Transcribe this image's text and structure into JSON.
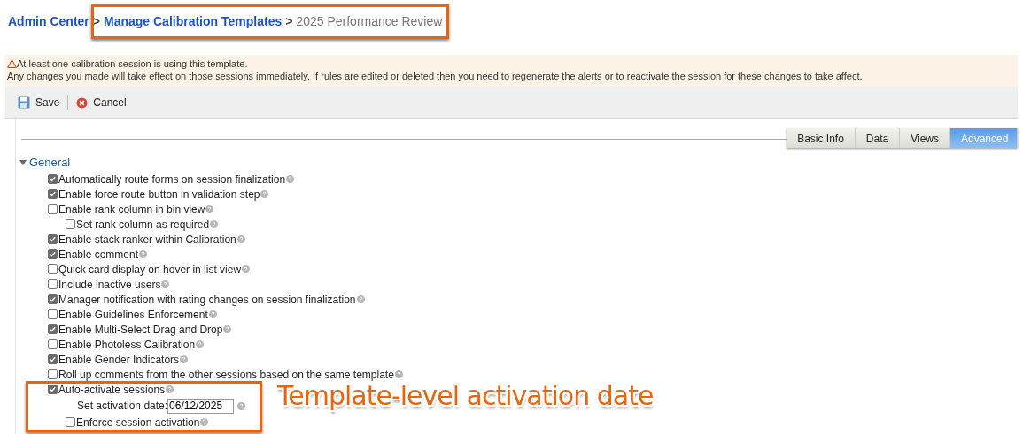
{
  "breadcrumb": [
    {
      "label": "Admin Center",
      "kind": "link"
    },
    {
      "label": "Manage Calibration Templates",
      "kind": "link"
    },
    {
      "label": "2025 Performance Review",
      "kind": "current"
    }
  ],
  "breadcrumb_separator": ">",
  "alert": {
    "title": "At least one calibration session is using this template.",
    "message": "Any changes you made will take effect on those sessions immediately. If rules are edited or deleted then you need to regenerate the alerts or to reactivate the session for these changes to take affect."
  },
  "toolbar": [
    {
      "label": "Save",
      "kind": "save"
    },
    {
      "label": "Cancel",
      "kind": "cancel"
    }
  ],
  "tabs": [
    {
      "label": "Basic Info",
      "selected": false
    },
    {
      "label": "Data",
      "selected": false
    },
    {
      "label": "Views",
      "selected": false
    },
    {
      "label": "Advanced",
      "selected": true
    }
  ],
  "section": {
    "title": "General",
    "expanded": true,
    "items": [
      {
        "kind": "checkbox",
        "label": "Automatically route forms on session finalization",
        "checked": true
      },
      {
        "kind": "checkbox",
        "label": "Enable force route button in validation step",
        "checked": true
      },
      {
        "kind": "checkbox",
        "label": "Enable rank column in bin view",
        "checked": false,
        "children": [
          {
            "kind": "checkbox",
            "label": "Set rank column as required",
            "checked": false
          }
        ]
      },
      {
        "kind": "checkbox",
        "label": "Enable stack ranker within Calibration",
        "checked": true
      },
      {
        "kind": "checkbox",
        "label": "Enable comment",
        "checked": true
      },
      {
        "kind": "checkbox",
        "label": "Quick card display on hover in list view",
        "checked": false
      },
      {
        "kind": "checkbox",
        "label": "Include inactive users",
        "checked": false
      },
      {
        "kind": "checkbox",
        "label": "Manager notification with rating changes on session finalization",
        "checked": true
      },
      {
        "kind": "checkbox",
        "label": "Enable Guidelines Enforcement",
        "checked": false
      },
      {
        "kind": "checkbox",
        "label": "Enable Multi-Select Drag and Drop",
        "checked": true
      },
      {
        "kind": "checkbox",
        "label": "Enable Photoless Calibration",
        "checked": false
      },
      {
        "kind": "checkbox",
        "label": "Enable Gender Indicators",
        "checked": true
      },
      {
        "kind": "checkbox",
        "label": "Roll up comments from the other sessions based on the same template",
        "checked": false
      },
      {
        "kind": "checkbox",
        "label": "Auto-activate sessions",
        "checked": true,
        "children": [
          {
            "kind": "date",
            "label": "Set activation date:",
            "value": "06/12/2025"
          },
          {
            "kind": "checkbox",
            "label": "Enforce session activation",
            "checked": false
          }
        ]
      }
    ]
  },
  "annotation": {
    "callout": "Template-level activation date"
  }
}
